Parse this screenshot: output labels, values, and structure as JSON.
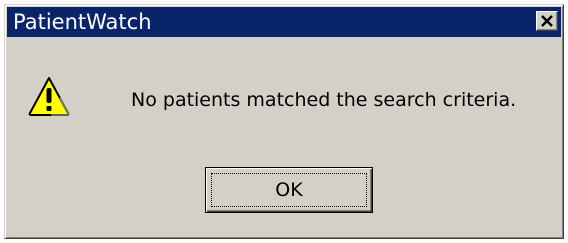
{
  "window": {
    "title": "PatientWatch",
    "close_icon": "close-icon",
    "titlebar_color": "#0a246a",
    "face_color": "#d4d0c8"
  },
  "dialog": {
    "icon": "warning-icon",
    "icon_color": "#ffff00",
    "message": "No patients matched the search criteria.",
    "ok_label": "OK"
  }
}
